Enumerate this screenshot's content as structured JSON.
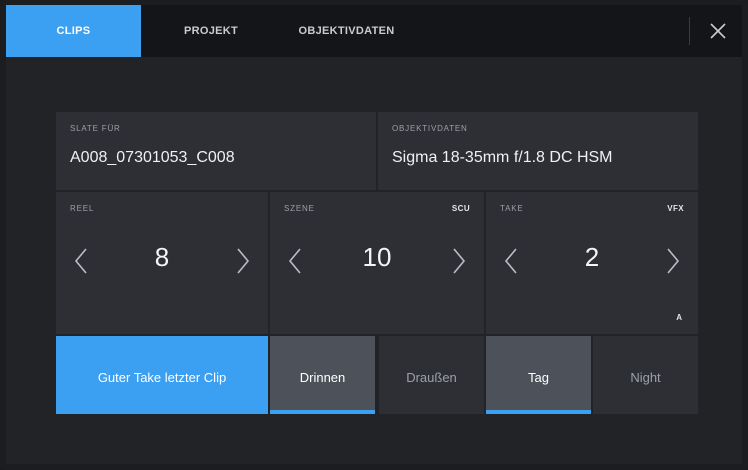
{
  "tabs": [
    {
      "label": "CLIPS",
      "active": true
    },
    {
      "label": "PROJEKT",
      "active": false
    },
    {
      "label": "OBJEKTIVDATEN",
      "active": false
    }
  ],
  "close_icon": "close-icon",
  "slate": {
    "label": "SLATE FÜR",
    "value": "A008_07301053_C008"
  },
  "lens": {
    "label": "OBJEKTIVDATEN",
    "value": "Sigma 18-35mm f/1.8 DC HSM"
  },
  "reel": {
    "label": "REEL",
    "value": "8"
  },
  "scene": {
    "label": "SZENE",
    "value": "10",
    "tag": "SCU"
  },
  "take": {
    "label": "TAKE",
    "value": "2",
    "tag": "VFX",
    "sub": "A"
  },
  "buttons": {
    "good_take": "Guter Take letzter Clip",
    "interior": "Drinnen",
    "exterior": "Draußen",
    "day": "Tag",
    "night": "Night"
  },
  "colors": {
    "accent": "#3b9ff2",
    "background": "#222327",
    "card": "#2d2f34",
    "selected": "#4d5159"
  },
  "icons": {
    "prev": "chevron-left-icon",
    "next": "chevron-right-icon",
    "close": "close-icon"
  }
}
